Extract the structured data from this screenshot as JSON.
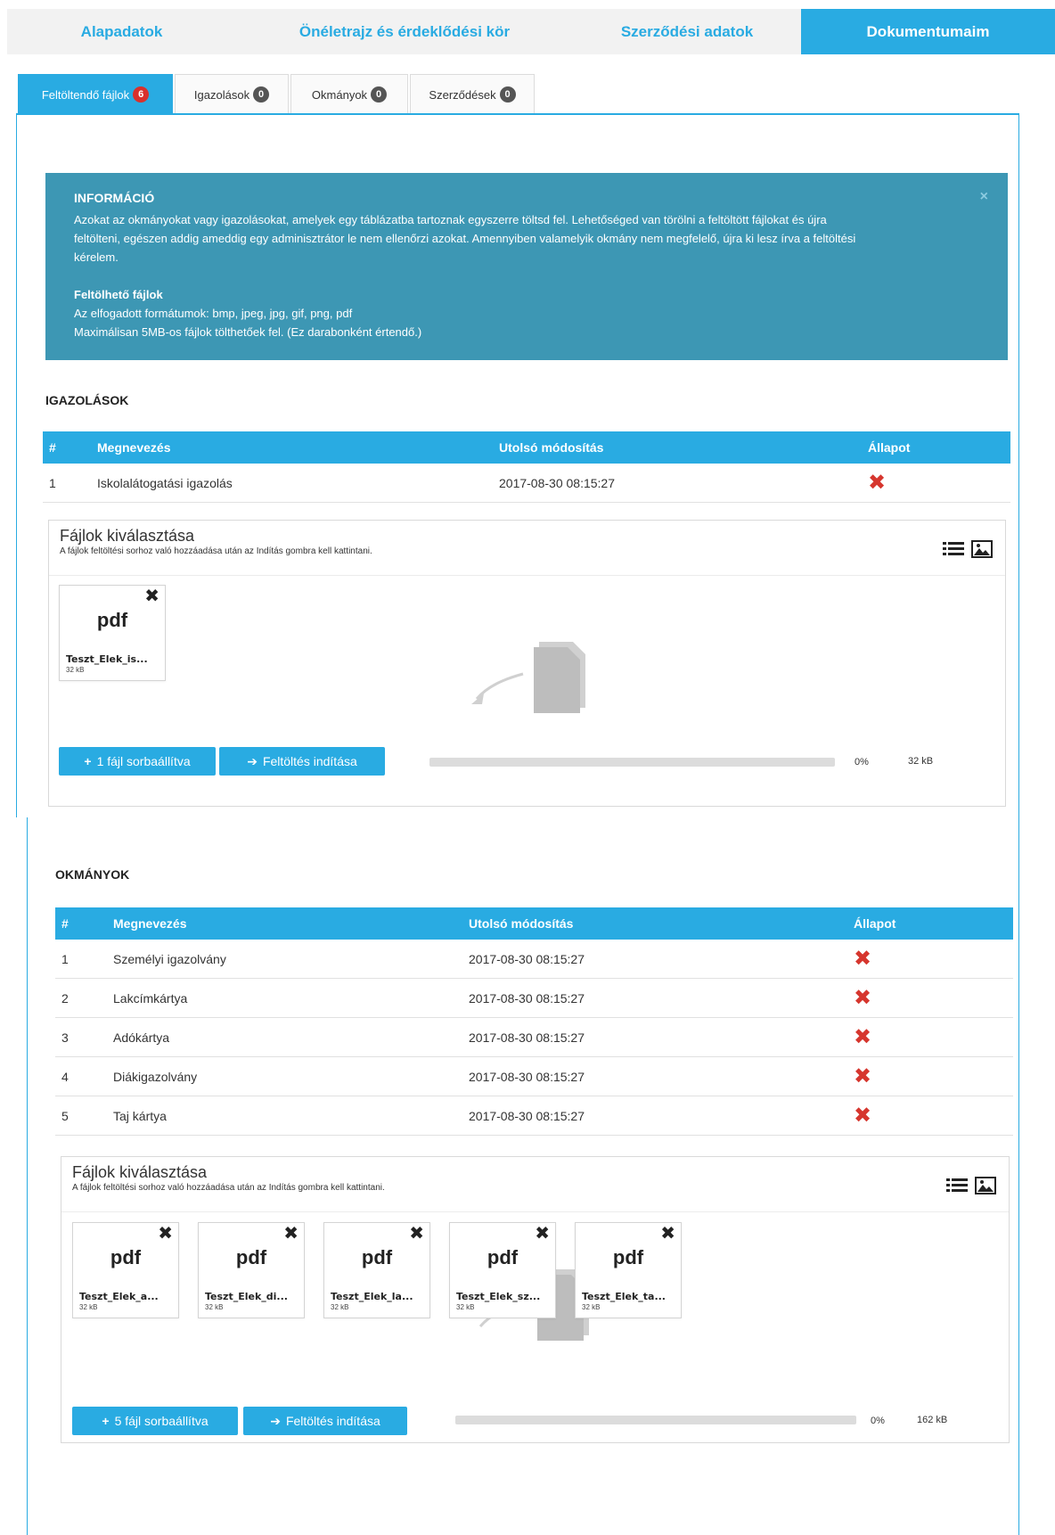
{
  "topnav": {
    "items": [
      {
        "label": "Alapadatok",
        "active": false
      },
      {
        "label": "Önéletrajz és érdeklődési kör",
        "active": false
      },
      {
        "label": "Szerződési adatok",
        "active": false
      },
      {
        "label": "Dokumentumaim",
        "active": true
      }
    ]
  },
  "tabs": [
    {
      "label": "Feltöltendő fájlok",
      "count": "6",
      "active": true
    },
    {
      "label": "Igazolások",
      "count": "0",
      "active": false
    },
    {
      "label": "Okmányok",
      "count": "0",
      "active": false
    },
    {
      "label": "Szerződések",
      "count": "0",
      "active": false
    }
  ],
  "info": {
    "title": "INFORMÁCIÓ",
    "line1": "Azokat az okmányokat vagy igazolásokat, amelyek egy táblázatba tartoznak egyszerre töltsd fel. Lehetőséged van törölni a feltöltött fájlokat és újra",
    "line2": "feltölteni, egészen addig ameddig egy adminisztrátor le nem ellenőrzi azokat. Amennyiben valamelyik okmány nem megfelelő, újra ki lesz írva a feltöltési",
    "line3": "kérelem.",
    "subtitle": "Feltölhető fájlok",
    "formats": "Az elfogadott formátumok: bmp, jpeg, jpg, gif, png, pdf",
    "maxsize": "Maximálisan 5MB-os fájlok tölthetőek fel. (Ez darabonként értendő.)",
    "close": "×"
  },
  "igazolasok": {
    "title": "IGAZOLÁSOK",
    "headers": {
      "num": "#",
      "name": "Megnevezés",
      "modified": "Utolsó módosítás",
      "status": "Állapot"
    },
    "rows": [
      {
        "num": "1",
        "name": "Iskolalátogatási igazolás",
        "modified": "2017-08-30 08:15:27",
        "status": "✖"
      }
    ],
    "uploader": {
      "title": "Fájlok kiválasztása",
      "subtitle": "A fájlok feltöltési sorhoz való hozzáadása után az Indítás gombra kell kattintani.",
      "files": [
        {
          "ext": "pdf",
          "name": "Teszt_Elek_is...",
          "size": "32 kB"
        }
      ],
      "queue_button": "1 fájl sorbaállítva",
      "start_button": "Feltöltés indítása",
      "progress": "0%",
      "total_size": "32 kB",
      "progress_value": 0
    }
  },
  "okmanyok": {
    "title": "OKMÁNYOK",
    "headers": {
      "num": "#",
      "name": "Megnevezés",
      "modified": "Utolsó módosítás",
      "status": "Állapot"
    },
    "rows": [
      {
        "num": "1",
        "name": "Személyi igazolvány",
        "modified": "2017-08-30 08:15:27",
        "status": "✖"
      },
      {
        "num": "2",
        "name": "Lakcímkártya",
        "modified": "2017-08-30 08:15:27",
        "status": "✖"
      },
      {
        "num": "3",
        "name": "Adókártya",
        "modified": "2017-08-30 08:15:27",
        "status": "✖"
      },
      {
        "num": "4",
        "name": "Diákigazolvány",
        "modified": "2017-08-30 08:15:27",
        "status": "✖"
      },
      {
        "num": "5",
        "name": "Taj kártya",
        "modified": "2017-08-30 08:15:27",
        "status": "✖"
      }
    ],
    "uploader": {
      "title": "Fájlok kiválasztása",
      "subtitle": "A fájlok feltöltési sorhoz való hozzáadása után az Indítás gombra kell kattintani.",
      "files": [
        {
          "ext": "pdf",
          "name": "Teszt_Elek_a...",
          "size": "32 kB"
        },
        {
          "ext": "pdf",
          "name": "Teszt_Elek_di...",
          "size": "32 kB"
        },
        {
          "ext": "pdf",
          "name": "Teszt_Elek_la...",
          "size": "32 kB"
        },
        {
          "ext": "pdf",
          "name": "Teszt_Elek_sz...",
          "size": "32 kB"
        },
        {
          "ext": "pdf",
          "name": "Teszt_Elek_ta...",
          "size": "32 kB"
        }
      ],
      "queue_button": "5 fájl sorbaállítva",
      "start_button": "Feltöltés indítása",
      "progress": "0%",
      "total_size": "162 kB",
      "progress_value": 0
    }
  },
  "icons": {
    "remove": "✖",
    "plus": "+",
    "arrow": "➔"
  },
  "colors": {
    "accent": "#29abe2",
    "info_bg": "#3d97b4",
    "error": "#d6362e",
    "badge_red": "#d9302c"
  }
}
